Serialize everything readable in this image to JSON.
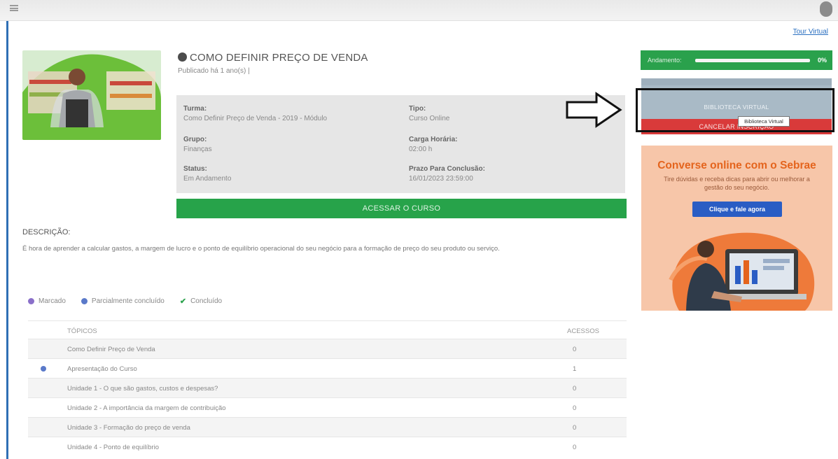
{
  "topbar": {
    "menu_icon": "menu-icon",
    "user_icon": "user-icon"
  },
  "tour_link": "Tour Virtual",
  "course": {
    "title": "COMO DEFINIR PREÇO DE VENDA",
    "published": "Publicado há 1 ano(s)  |",
    "info": [
      {
        "label": "Turma:",
        "value": "Como Definir Preço de Venda - 2019 - Módulo"
      },
      {
        "label": "Tipo:",
        "value": "Curso Online"
      },
      {
        "label": "Grupo:",
        "value": "Finanças"
      },
      {
        "label": "Carga Horária:",
        "value": "02:00 h"
      },
      {
        "label": "Status:",
        "value": "Em Andamento"
      },
      {
        "label": "Prazo Para Conclusão:",
        "value": "16/01/2023 23:59:00"
      }
    ],
    "access_button": "ACESSAR O CURSO"
  },
  "description": {
    "label": "DESCRIÇÃO:",
    "text": "É hora de aprender a calcular gastos, a margem de lucro e o ponto de equilíbrio operacional do seu negócio para a formação de preço do seu produto ou serviço."
  },
  "legend": {
    "marked": "Marcado",
    "partial": "Parcialmente concluído",
    "done": "Concluído"
  },
  "table": {
    "headers": {
      "topics": "TÓPICOS",
      "accesses": "ACESSOS"
    },
    "rows": [
      {
        "topic": "Como Definir Preço de Venda",
        "accesses": "0",
        "marker": false
      },
      {
        "topic": "Apresentação do Curso",
        "accesses": "1",
        "marker": true
      },
      {
        "topic": "Unidade 1 - O que são gastos, custos e despesas?",
        "accesses": "0",
        "marker": false
      },
      {
        "topic": "Unidade 2 - A importância da margem de contribuição",
        "accesses": "0",
        "marker": false
      },
      {
        "topic": "Unidade 3 - Formação do preço de venda",
        "accesses": "0",
        "marker": false
      },
      {
        "topic": "Unidade 4 - Ponto de equilíbrio",
        "accesses": "0",
        "marker": false
      }
    ]
  },
  "sidebar": {
    "progress_label": "Andamento:",
    "progress_value": 0.0,
    "progress_pct": "0%",
    "biblioteca_button": "BIBLIOTECA VIRTUAL",
    "cancel_button": "CANCELAR INSCRIÇÃO",
    "tooltip": "Biblioteca Virtual"
  },
  "ad": {
    "title": "Converse online com o Sebrae",
    "subtitle": "Tire dúvidas e receba dicas para abrir ou melhorar a gestão do seu negócio.",
    "button": "Clique e fale agora"
  },
  "colors": {
    "green": "#27a34a",
    "red": "#d93a3a",
    "orange_title": "#e4641d",
    "ad_bg": "#f7c6a9",
    "blue_button": "#2a5dc4",
    "marker_blue": "#5a79c9"
  }
}
